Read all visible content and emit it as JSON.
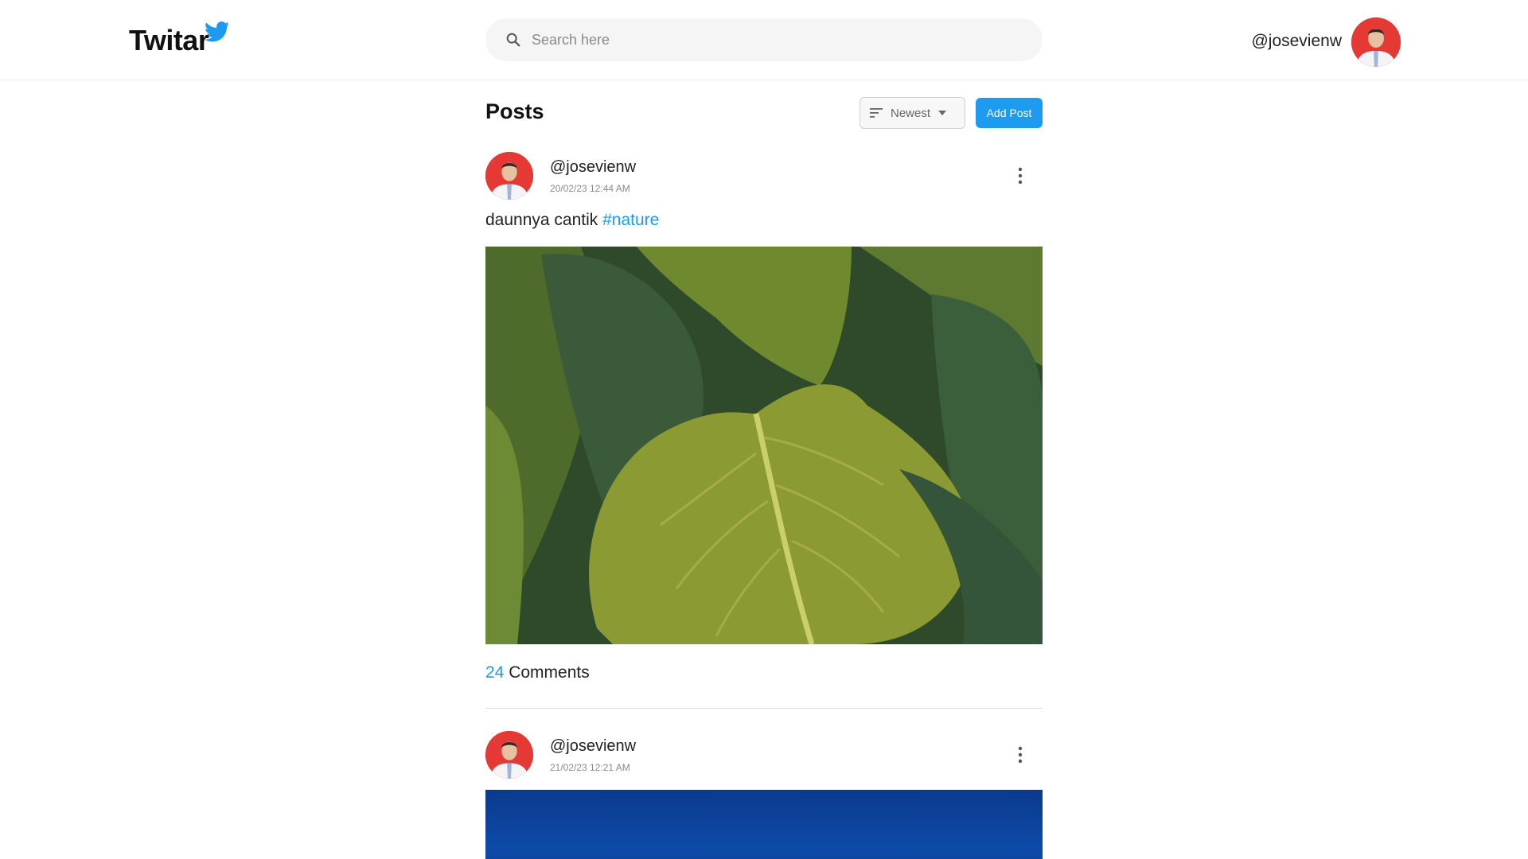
{
  "app": {
    "name": "Twitar"
  },
  "search": {
    "placeholder": "Search here"
  },
  "current_user": {
    "handle": "@josevienw"
  },
  "feed": {
    "title": "Posts",
    "sort": {
      "label": "Newest"
    },
    "add_post_label": "Add Post"
  },
  "posts": [
    {
      "author": "@josevienw",
      "timestamp": "20/02/23 12:44 AM",
      "text": "daunnya cantik",
      "hashtag": "#nature",
      "comment_count": "24",
      "comments_label": "Comments"
    },
    {
      "author": "@josevienw",
      "timestamp": "21/02/23 12:21 AM"
    }
  ],
  "colors": {
    "accent": "#1d9bf0",
    "avatar_bg": "#e53935"
  },
  "icons": [
    "bird-logo-icon",
    "search-icon",
    "sort-icon",
    "caret-down-icon",
    "more-vert-icon"
  ]
}
